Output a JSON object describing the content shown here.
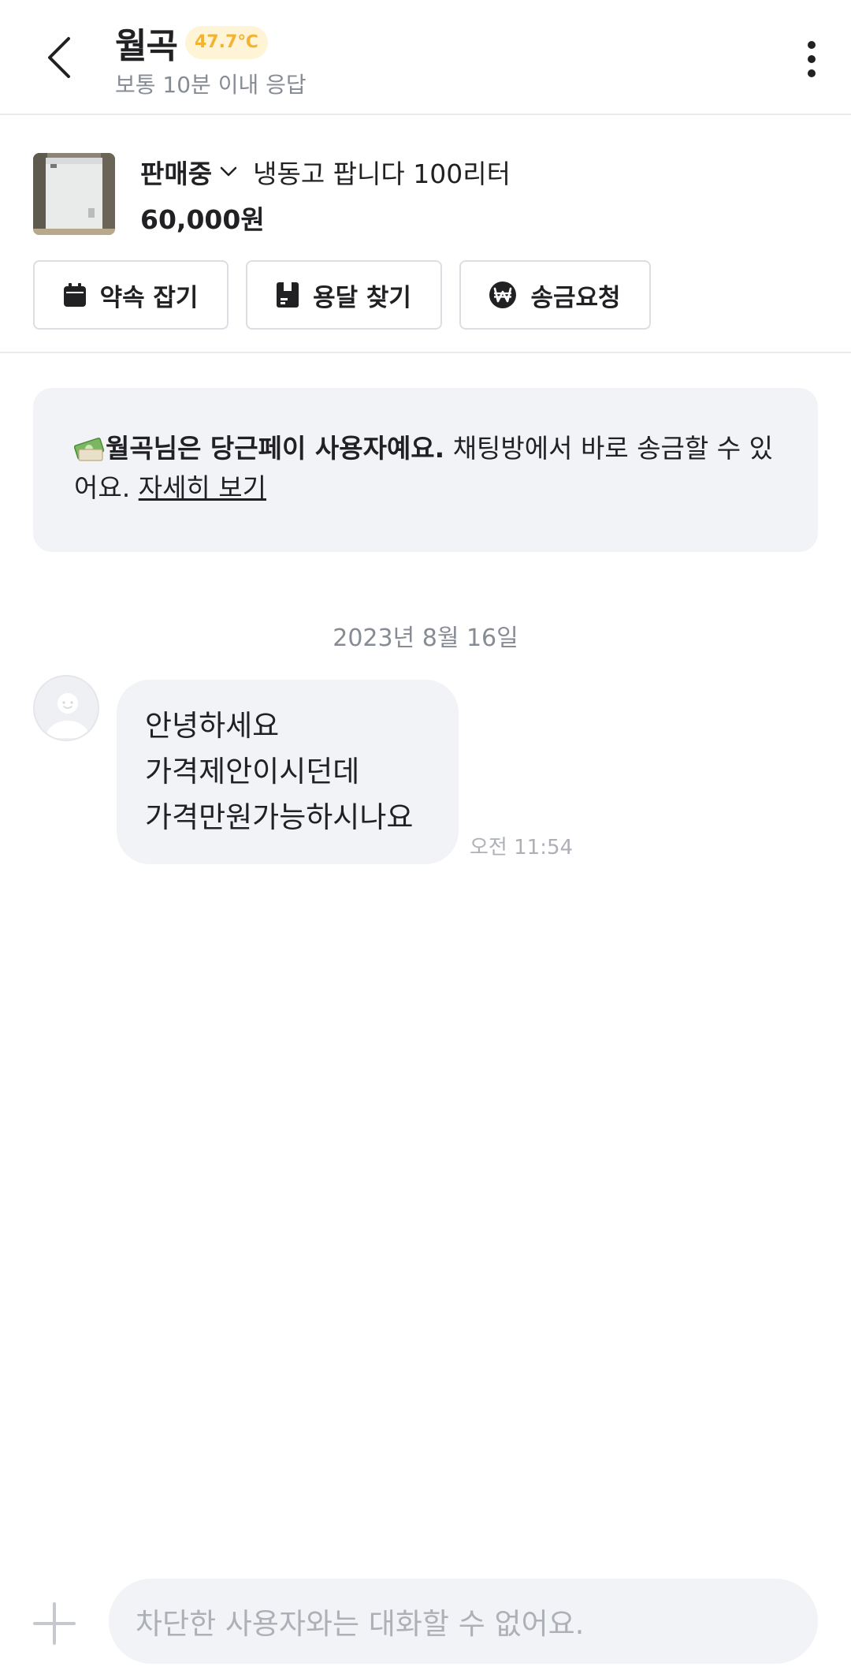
{
  "header": {
    "title": "월곡",
    "temperature": "47.7℃",
    "response_time": "보통 10분 이내 응답",
    "back_icon": "chevron-left-icon",
    "more_icon": "more-vertical-icon"
  },
  "product": {
    "status": "판매중",
    "name": "냉동고 팝니다 100리터",
    "price": "60,000원"
  },
  "actions": {
    "appointment": "약속 잡기",
    "container": "용달 찾기",
    "remit": "송금요청"
  },
  "banner": {
    "bold_text": "월곡님은 당근페이 사용자예요.",
    "text": " 채팅방에서 바로 송금할 수 있어요. ",
    "link": "자세히 보기"
  },
  "chat": {
    "date": "2023년 8월 16일",
    "messages": [
      {
        "lines": [
          "안녕하세요",
          "가격제안이시던데",
          "가격만원가능하시나요"
        ],
        "time": "오전 11:54"
      }
    ]
  },
  "input": {
    "placeholder": "차단한 사용자와는 대화할 수 없어요."
  },
  "colors": {
    "temperature_text": "#f2b430",
    "temperature_bg": "#fff4d6",
    "bubble_bg": "#f2f3f6",
    "muted": "#868b94"
  }
}
